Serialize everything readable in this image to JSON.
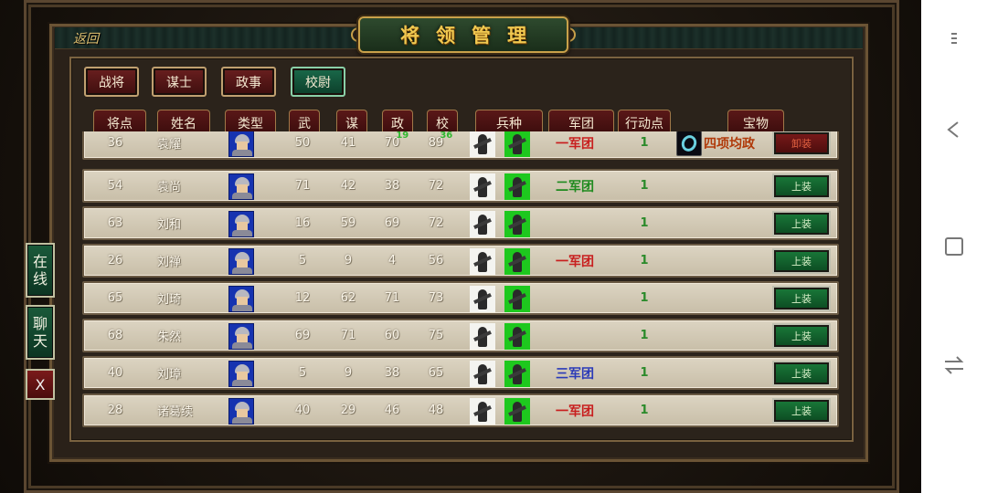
{
  "header": {
    "back_label": "返回",
    "title": "将领管理"
  },
  "tabs": [
    {
      "label": "战将",
      "active": false
    },
    {
      "label": "谋士",
      "active": false
    },
    {
      "label": "政事",
      "active": false
    },
    {
      "label": "校尉",
      "active": true
    }
  ],
  "columns": [
    "将点",
    "姓名",
    "类型",
    "武",
    "谋",
    "政",
    "校",
    "兵种",
    "军团",
    "行动点",
    "宝物"
  ],
  "rows": [
    {
      "points": "36",
      "name": "袁耀",
      "wu": "50",
      "mou": "41",
      "zheng": "70",
      "zheng_bonus": "19",
      "xiao": "89",
      "xiao_bonus": "36",
      "legion": "一军团",
      "legion_color": "#c81e1e",
      "action_points": "1",
      "treasure": "四项均政",
      "button": "卸装",
      "button_type": "unequip"
    },
    {
      "points": "54",
      "name": "袁尚",
      "wu": "71",
      "mou": "42",
      "zheng": "38",
      "zheng_bonus": "",
      "xiao": "72",
      "xiao_bonus": "",
      "legion": "二军团",
      "legion_color": "#1e8a1e",
      "action_points": "1",
      "treasure": "",
      "button": "上装",
      "button_type": "equip"
    },
    {
      "points": "63",
      "name": "刘和",
      "wu": "16",
      "mou": "59",
      "zheng": "69",
      "zheng_bonus": "",
      "xiao": "72",
      "xiao_bonus": "",
      "legion": "",
      "legion_color": "#c81e1e",
      "action_points": "1",
      "treasure": "",
      "button": "上装",
      "button_type": "equip"
    },
    {
      "points": "26",
      "name": "刘禅",
      "wu": "5",
      "mou": "9",
      "zheng": "4",
      "zheng_bonus": "",
      "xiao": "56",
      "xiao_bonus": "",
      "legion": "一军团",
      "legion_color": "#c81e1e",
      "action_points": "1",
      "treasure": "",
      "button": "上装",
      "button_type": "equip"
    },
    {
      "points": "65",
      "name": "刘琦",
      "wu": "12",
      "mou": "62",
      "zheng": "71",
      "zheng_bonus": "",
      "xiao": "73",
      "xiao_bonus": "",
      "legion": "",
      "legion_color": "#c81e1e",
      "action_points": "1",
      "treasure": "",
      "button": "上装",
      "button_type": "equip"
    },
    {
      "points": "68",
      "name": "朱然",
      "wu": "69",
      "mou": "71",
      "zheng": "60",
      "zheng_bonus": "",
      "xiao": "75",
      "xiao_bonus": "",
      "legion": "",
      "legion_color": "#c81e1e",
      "action_points": "1",
      "treasure": "",
      "button": "上装",
      "button_type": "equip"
    },
    {
      "points": "40",
      "name": "刘璋",
      "wu": "5",
      "mou": "9",
      "zheng": "38",
      "zheng_bonus": "",
      "xiao": "65",
      "xiao_bonus": "",
      "legion": "三军团",
      "legion_color": "#2a3ab8",
      "action_points": "1",
      "treasure": "",
      "button": "上装",
      "button_type": "equip"
    },
    {
      "points": "28",
      "name": "诸葛续",
      "wu": "40",
      "mou": "29",
      "zheng": "46",
      "zheng_bonus": "",
      "xiao": "48",
      "xiao_bonus": "",
      "legion": "一军团",
      "legion_color": "#c81e1e",
      "action_points": "1",
      "treasure": "",
      "button": "上装",
      "button_type": "equip"
    }
  ],
  "side": {
    "online_label": "在线",
    "chat_label": "聊天",
    "close_label": "X"
  },
  "icons": {
    "portrait": "general-portrait-icon",
    "infantry": "infantry-unit-icon",
    "cavalry": "cavalry-unit-icon",
    "treasure": "jade-ring-icon"
  }
}
